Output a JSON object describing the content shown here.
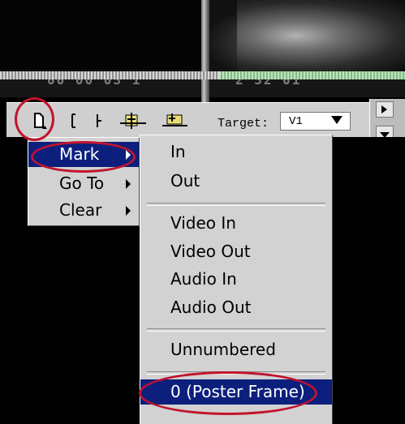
{
  "timecodes": {
    "left": "00 00 03 1",
    "right": "2 32 01"
  },
  "toolbar": {
    "target_label": "Target:",
    "target_value": "V1"
  },
  "main_menu": {
    "items": [
      {
        "label": "Mark",
        "selected": true
      },
      {
        "label": "Go To",
        "selected": false
      },
      {
        "label": "Clear",
        "selected": false
      }
    ]
  },
  "submenu": {
    "items": [
      {
        "label": "In"
      },
      {
        "label": "Out"
      },
      {
        "label": "Video In"
      },
      {
        "label": "Video Out"
      },
      {
        "label": "Audio In"
      },
      {
        "label": "Audio Out"
      },
      {
        "label": "Unnumbered"
      },
      {
        "label": "0 (Poster Frame)",
        "selected": true
      }
    ]
  },
  "icons": [
    "marker-menu-icon",
    "set-in-point-icon",
    "set-out-point-icon",
    "insert-edit-icon",
    "overlay-edit-icon",
    "play-next-icon",
    "dropdown-arrow-icon"
  ],
  "colors": {
    "menu_background": "#d2d2d2",
    "selection": "#0c1f7d",
    "annotation": "#c1142d"
  }
}
